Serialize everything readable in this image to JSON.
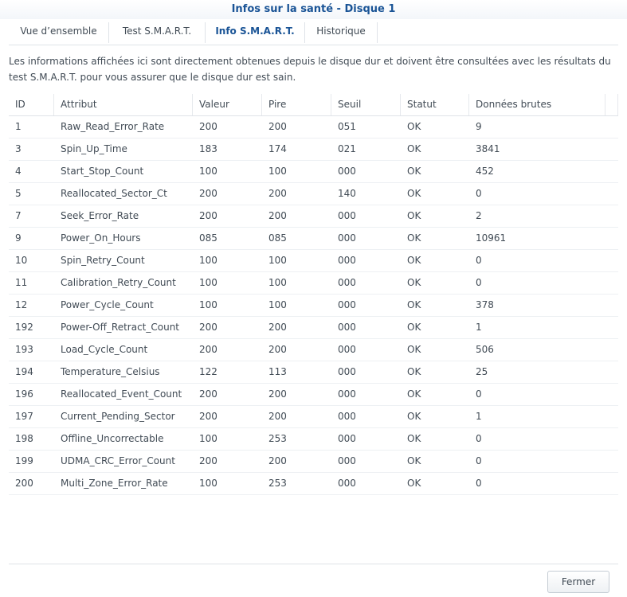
{
  "window": {
    "title": "Infos sur la santé - Disque 1"
  },
  "tabs": [
    {
      "label": "Vue d’ensemble",
      "active": false
    },
    {
      "label": "Test S.M.A.R.T.",
      "active": false
    },
    {
      "label": "Info S.M.A.R.T.",
      "active": true
    },
    {
      "label": "Historique",
      "active": false
    }
  ],
  "description": "Les informations affichées ici sont directement obtenues depuis le disque dur et doivent être consultées avec les résultats du test S.M.A.R.T. pour vous assurer que le disque dur est sain.",
  "table": {
    "columns": [
      "ID",
      "Attribut",
      "Valeur",
      "Pire",
      "Seuil",
      "Statut",
      "Données brutes"
    ],
    "rows": [
      [
        "1",
        "Raw_Read_Error_Rate",
        "200",
        "200",
        "051",
        "OK",
        "9"
      ],
      [
        "3",
        "Spin_Up_Time",
        "183",
        "174",
        "021",
        "OK",
        "3841"
      ],
      [
        "4",
        "Start_Stop_Count",
        "100",
        "100",
        "000",
        "OK",
        "452"
      ],
      [
        "5",
        "Reallocated_Sector_Ct",
        "200",
        "200",
        "140",
        "OK",
        "0"
      ],
      [
        "7",
        "Seek_Error_Rate",
        "200",
        "200",
        "000",
        "OK",
        "2"
      ],
      [
        "9",
        "Power_On_Hours",
        "085",
        "085",
        "000",
        "OK",
        "10961"
      ],
      [
        "10",
        "Spin_Retry_Count",
        "100",
        "100",
        "000",
        "OK",
        "0"
      ],
      [
        "11",
        "Calibration_Retry_Count",
        "100",
        "100",
        "000",
        "OK",
        "0"
      ],
      [
        "12",
        "Power_Cycle_Count",
        "100",
        "100",
        "000",
        "OK",
        "378"
      ],
      [
        "192",
        "Power-Off_Retract_Count",
        "200",
        "200",
        "000",
        "OK",
        "1"
      ],
      [
        "193",
        "Load_Cycle_Count",
        "200",
        "200",
        "000",
        "OK",
        "506"
      ],
      [
        "194",
        "Temperature_Celsius",
        "122",
        "113",
        "000",
        "OK",
        "25"
      ],
      [
        "196",
        "Reallocated_Event_Count",
        "200",
        "200",
        "000",
        "OK",
        "0"
      ],
      [
        "197",
        "Current_Pending_Sector",
        "200",
        "200",
        "000",
        "OK",
        "1"
      ],
      [
        "198",
        "Offline_Uncorrectable",
        "100",
        "253",
        "000",
        "OK",
        "0"
      ],
      [
        "199",
        "UDMA_CRC_Error_Count",
        "200",
        "200",
        "000",
        "OK",
        "0"
      ],
      [
        "200",
        "Multi_Zone_Error_Rate",
        "100",
        "253",
        "000",
        "OK",
        "0"
      ]
    ]
  },
  "footer": {
    "close_label": "Fermer"
  },
  "colors": {
    "title": "#1a5496",
    "text": "#414b55",
    "border": "#dfe3e8"
  }
}
